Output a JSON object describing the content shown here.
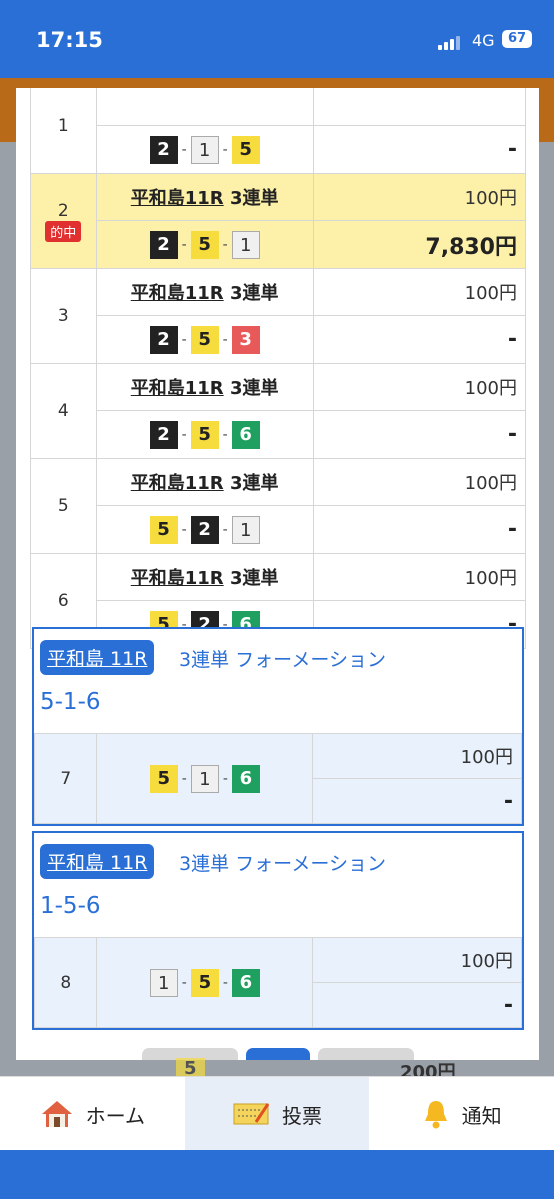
{
  "status": {
    "time": "17:15",
    "network": "4G",
    "battery": "67"
  },
  "rows": [
    {
      "no": "1",
      "race": "",
      "amount": "",
      "payout": "-",
      "combo": [
        "2",
        "1",
        "5"
      ],
      "hit": false
    },
    {
      "no": "2",
      "badge": "的中",
      "race": "平和島11R",
      "type": "3連単",
      "amount": "100円",
      "payout": "7,830円",
      "combo": [
        "2",
        "5",
        "1"
      ],
      "hit": true
    },
    {
      "no": "3",
      "race": "平和島11R",
      "type": "3連単",
      "amount": "100円",
      "payout": "-",
      "combo": [
        "2",
        "5",
        "3"
      ],
      "hit": false
    },
    {
      "no": "4",
      "race": "平和島11R",
      "type": "3連単",
      "amount": "100円",
      "payout": "-",
      "combo": [
        "2",
        "5",
        "6"
      ],
      "hit": false
    },
    {
      "no": "5",
      "race": "平和島11R",
      "type": "3連単",
      "amount": "100円",
      "payout": "-",
      "combo": [
        "5",
        "2",
        "1"
      ],
      "hit": false
    },
    {
      "no": "6",
      "race": "平和島11R",
      "type": "3連単",
      "amount": "100円",
      "payout": "-",
      "combo": [
        "5",
        "2",
        "6"
      ],
      "hit": false
    }
  ],
  "formations": [
    {
      "race": "平和島 11R",
      "kind": "3連単 フォーメーション",
      "combo_text": "5-1-6",
      "no": "7",
      "combo": [
        "5",
        "1",
        "6"
      ],
      "amount": "100円",
      "payout": "-"
    },
    {
      "race": "平和島 11R",
      "kind": "3連単 フォーメーション",
      "combo_text": "1-5-6",
      "no": "8",
      "combo": [
        "1",
        "5",
        "6"
      ],
      "amount": "100円",
      "payout": "-"
    }
  ],
  "peek": {
    "badge": "5",
    "amount": "200円"
  },
  "tabbar": [
    {
      "label": "ホーム",
      "icon": "home-icon"
    },
    {
      "label": "投票",
      "icon": "ticket-icon"
    },
    {
      "label": "通知",
      "icon": "bell-icon"
    }
  ],
  "colors": {
    "accent": "#2a6fd6",
    "hit": "#fdf0a8",
    "badge": "#e03030"
  }
}
